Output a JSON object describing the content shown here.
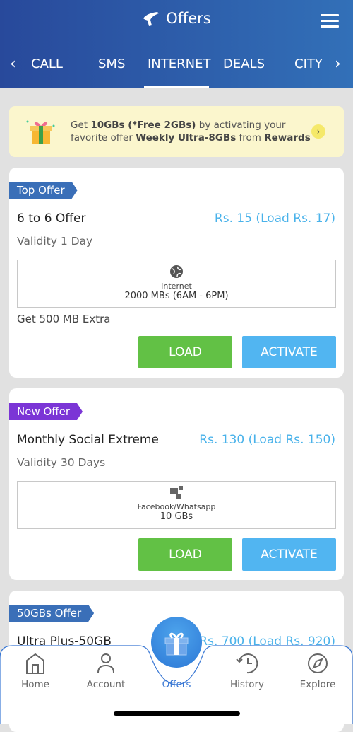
{
  "header": {
    "title": "Offers",
    "tabs": [
      "CALL",
      "SMS",
      "INTERNET",
      "DEALS",
      "CITY"
    ],
    "active_tab": "INTERNET"
  },
  "banner": {
    "t1": "Get ",
    "b1": "10GBs (*Free 2GBs)",
    "t2": " by activating your",
    "t3": "favorite offer ",
    "b2": "Weekly Ultra-8GBs",
    "t4": " from ",
    "b3": "Rewards"
  },
  "offers": [
    {
      "tag": "Top Offer",
      "tag_color": "#3a6fb8",
      "name": "6 to 6 Offer",
      "price": "Rs. 15 (Load Rs. 17)",
      "validity": "Validity 1 Day",
      "category": "Internet",
      "amount": "2000 MBs (6AM - 6PM)",
      "extra": "Get 500 MB Extra",
      "load": "LOAD",
      "activate": "ACTIVATE"
    },
    {
      "tag": "New Offer",
      "tag_color": "#7b35d6",
      "name": "Monthly Social Extreme",
      "price": "Rs. 130 (Load Rs. 150)",
      "validity": "Validity 30 Days",
      "category": "Facebook/Whatsapp",
      "amount": "10 GBs",
      "load": "LOAD",
      "activate": "ACTIVATE"
    },
    {
      "tag": "50GBs Offer",
      "tag_color": "#3a6fb8",
      "name": "Ultra Plus-50GB",
      "price": "Rs. 700 (Load Rs. 920)"
    }
  ],
  "nav": {
    "items": [
      "Home",
      "Account",
      "Offers",
      "History",
      "Explore"
    ],
    "active": "Offers",
    "active_color": "#3a78d4"
  }
}
